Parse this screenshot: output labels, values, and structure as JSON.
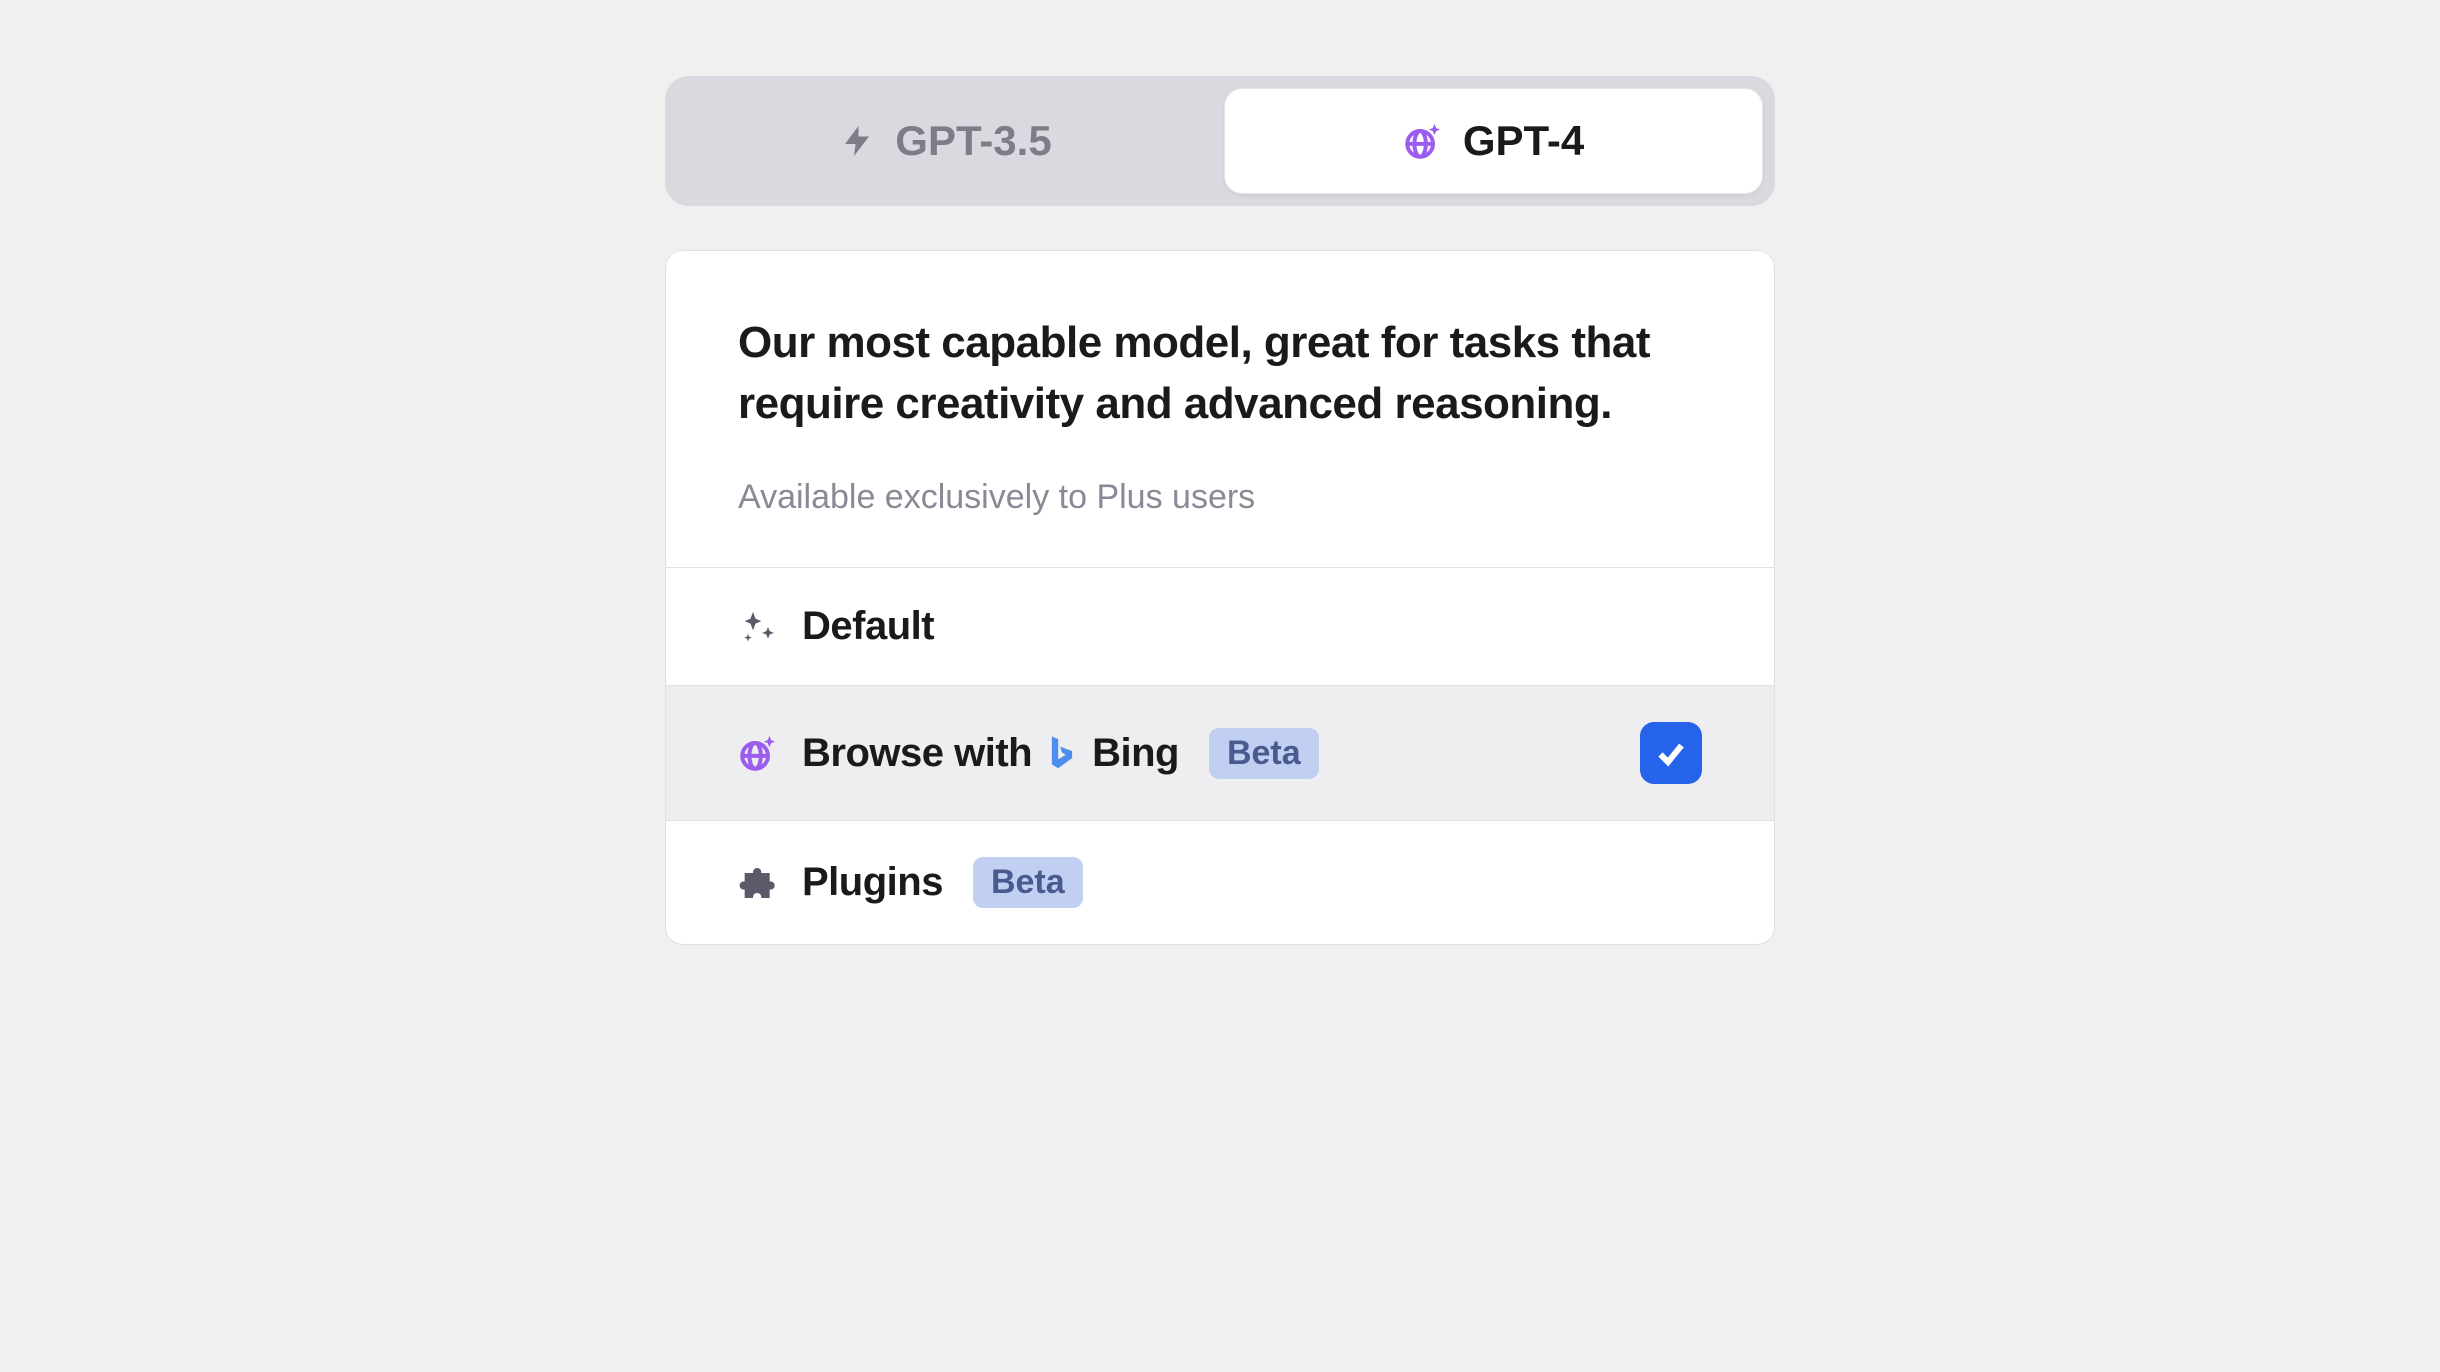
{
  "colors": {
    "purple": "#9b5cf0",
    "blue": "#2563eb"
  },
  "toggle": {
    "options": [
      {
        "label": "GPT-3.5",
        "active": false
      },
      {
        "label": "GPT-4",
        "active": true
      }
    ]
  },
  "panel": {
    "description": "Our most capable model, great for tasks that require creativity and advanced reasoning.",
    "availability": "Available exclusively to Plus users",
    "options": [
      {
        "label": "Default"
      },
      {
        "label_prefix": "Browse with",
        "label_suffix": "Bing",
        "beta": "Beta",
        "selected": true
      },
      {
        "label": "Plugins",
        "beta": "Beta"
      }
    ]
  }
}
